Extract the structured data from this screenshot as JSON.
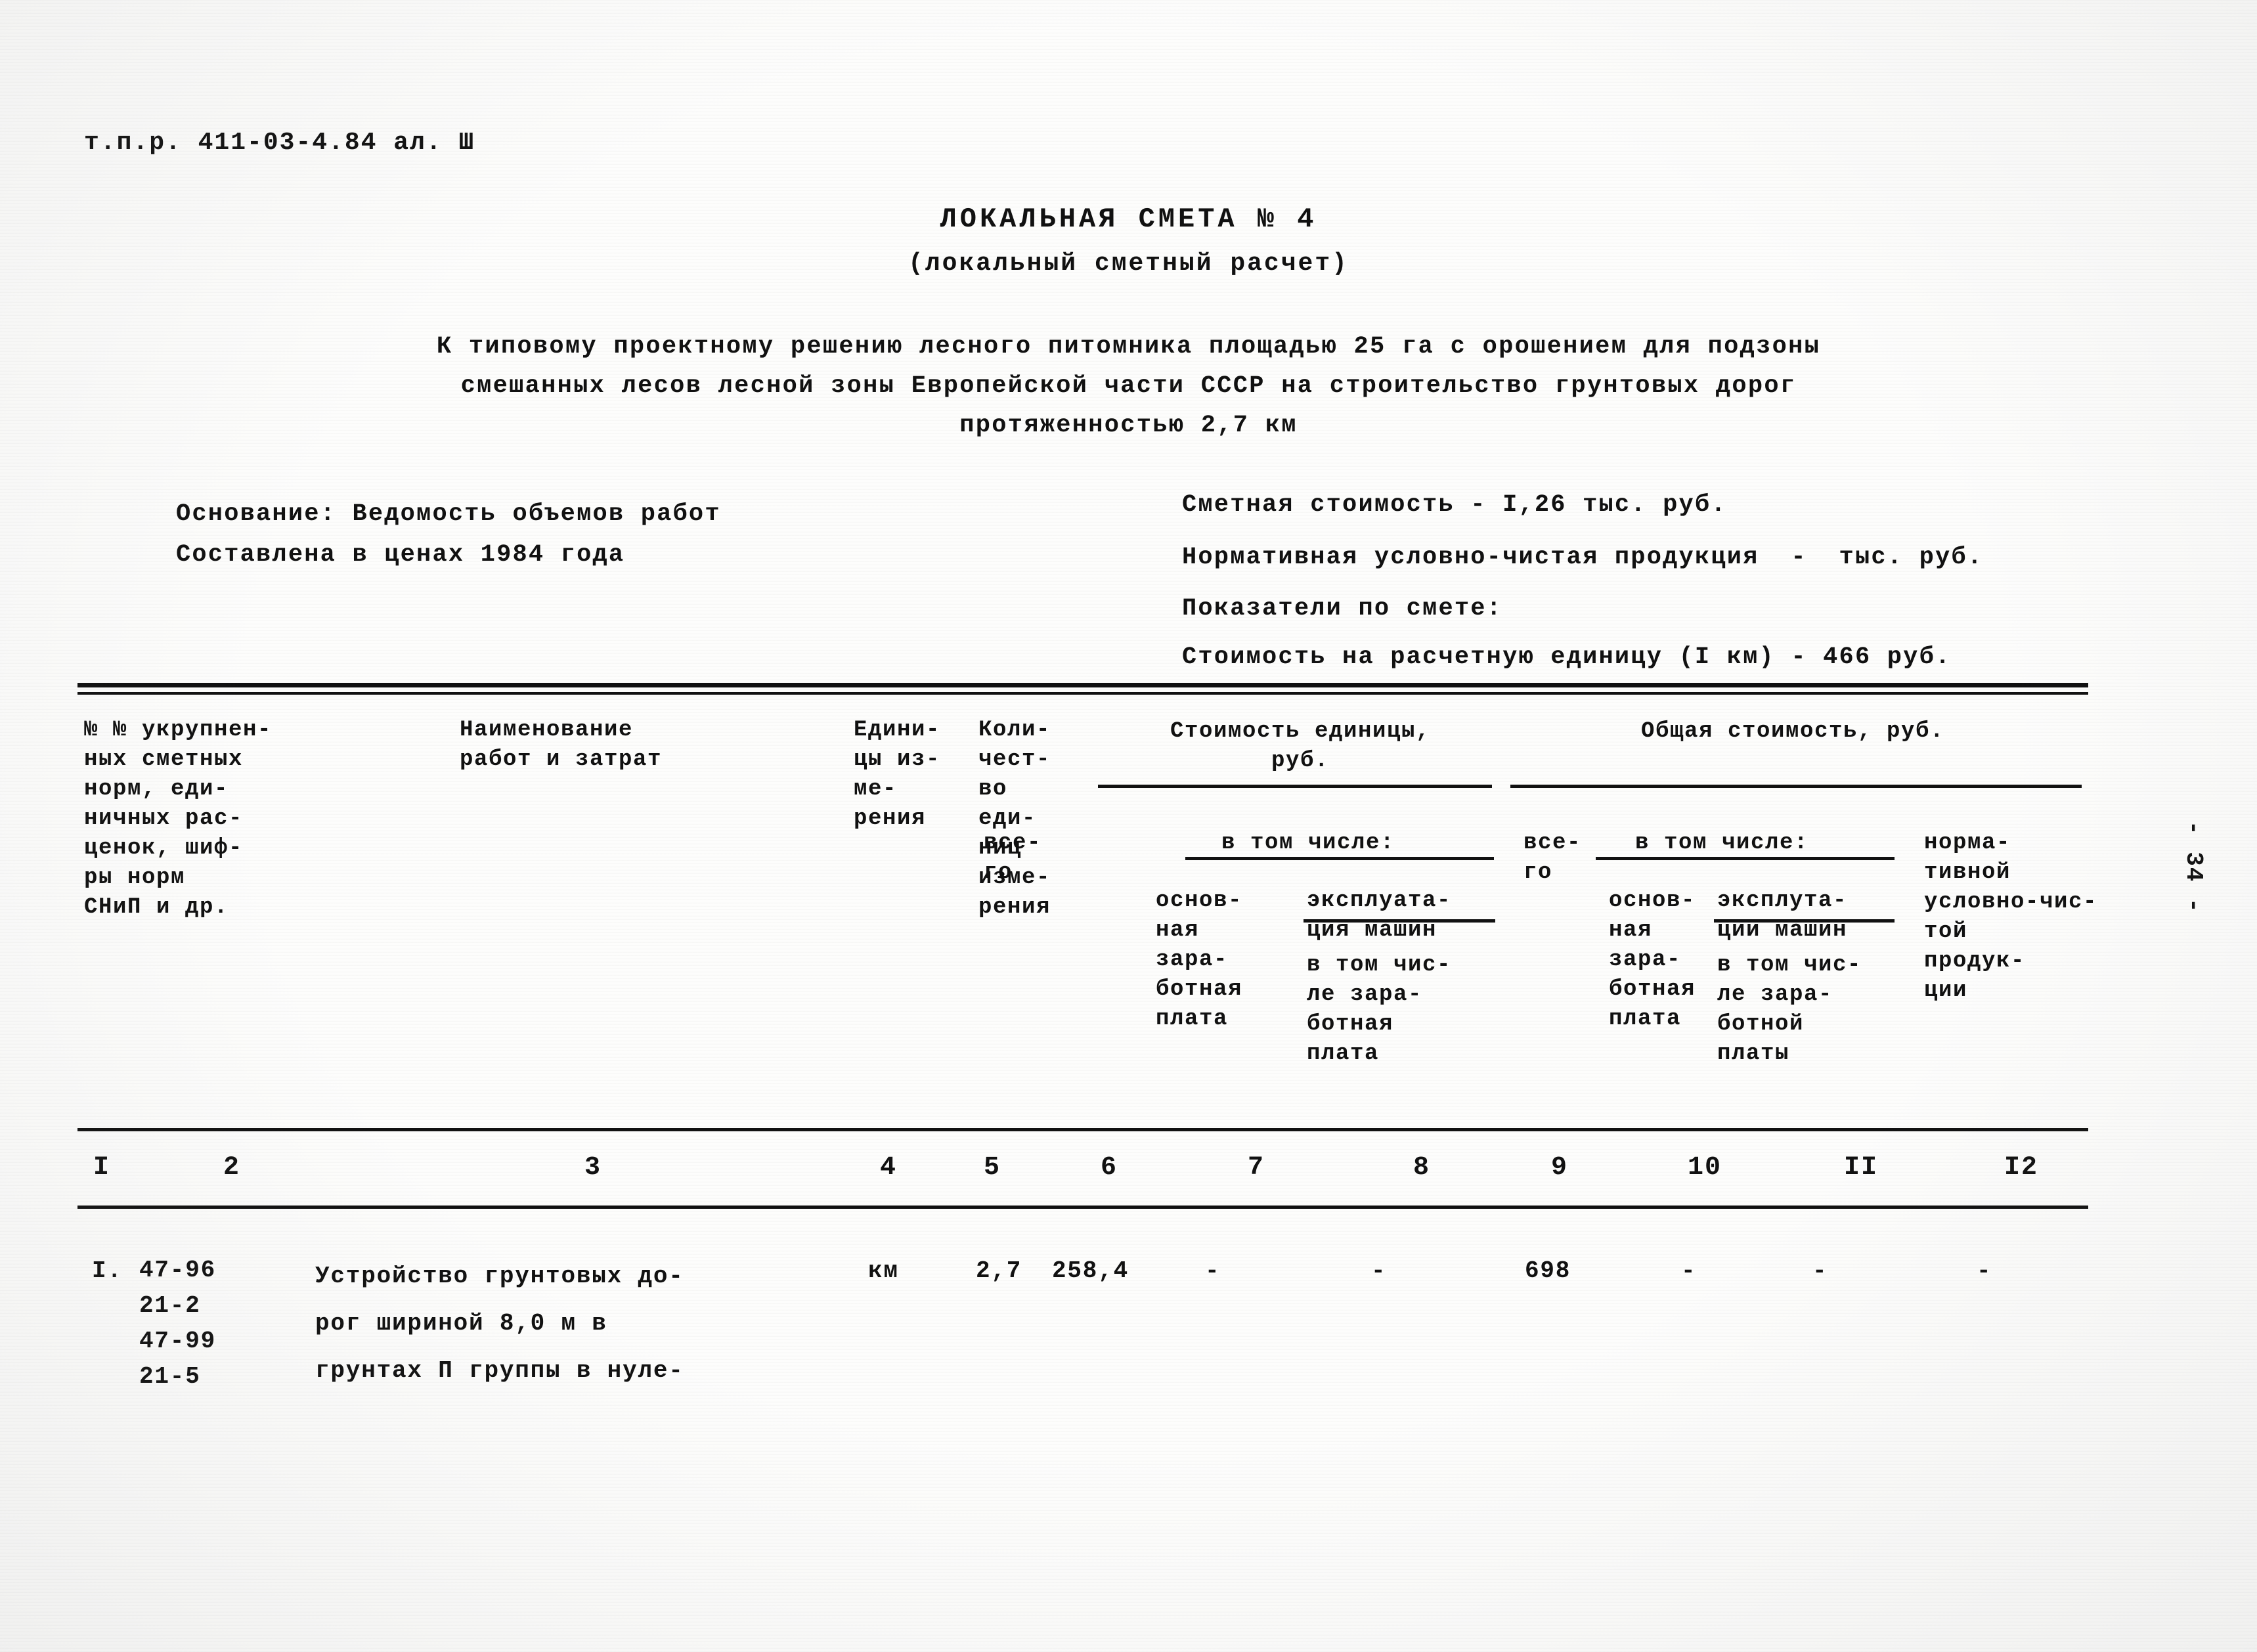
{
  "document": {
    "code_line": "т.п.р. 411-03-4.84 ал. Ш",
    "title": "ЛОКАЛЬНАЯ СМЕТА № 4",
    "subtitle": "(локальный сметный расчет)",
    "intro_line1": "К типовому проектному решению лесного питомника площадью 25 га с орошением для подзоны",
    "intro_line2": "смешанных лесов лесной зоны Европейской части СССР на строительство грунтовых дорог",
    "intro_line3": "протяженностью 2,7 км",
    "page_marker": "- 34 -"
  },
  "basis": {
    "line1": "Основание: Ведомость объемов работ",
    "line2": "Составлена в ценах 1984 года"
  },
  "summary": {
    "line1": "Сметная стоимость - I,26 тыс. руб.",
    "line2": "Нормативная условно-чистая продукция  -  тыс. руб.",
    "line3": "Показатели по смете:",
    "line4": "Стоимость на расчетную единицу (I км) - 466 руб."
  },
  "table": {
    "headers": {
      "col1": "№ № укрупнен-\nных сметных\nнорм, еди-\nничных рас-\nценок, шиф-\nры норм\nСНиП и др.",
      "col2": "Наименование\nработ и затрат",
      "col3": "Едини-\nцы из-\nме-\nрения",
      "col4": "Коли-\nчест-\nво\nеди-\nниц\nизме-\nрения",
      "group_unit": "Стоимость единицы,\nруб.",
      "col5_total": "все-\nго",
      "in_which_unit": "в том числе:",
      "col7": "основ-\nная\nзара-\nботная\nплата",
      "col8": "эксплуата-\nция машин",
      "col8b": "в том чис-\nле зара-\nботная\nплата",
      "group_total": "Общая стоимость, руб.",
      "col9_total": "все-\nго",
      "in_which_total": "в том числе:",
      "col10": "основ-\nная\nзара-\nботная\nплата",
      "col11": "эксплута-\nции машин",
      "col11b": "в том чис-\nле зара-\nботной\nплаты",
      "col12": "норма-\nтивной\nусловно-чис-\nтой\nпродук-\nции"
    },
    "column_numbers": [
      "I",
      "2",
      "3",
      "4",
      "5",
      "6",
      "7",
      "8",
      "9",
      "10",
      "II",
      "I2"
    ],
    "rows": [
      {
        "no": "I.",
        "codes": "47-96\n21-2\n47-99\n21-5",
        "description": "Устройство грунтовых до-\nрог шириной 8,0 м в\nгрунтах П группы в нуле-",
        "unit": "км",
        "quantity": "2,7",
        "unit_total": "258,4",
        "unit_basic_wage": "-",
        "unit_machines": "-",
        "total_all": "698",
        "total_basic_wage": "-",
        "total_machines": "-",
        "total_nucp": "-"
      }
    ]
  }
}
